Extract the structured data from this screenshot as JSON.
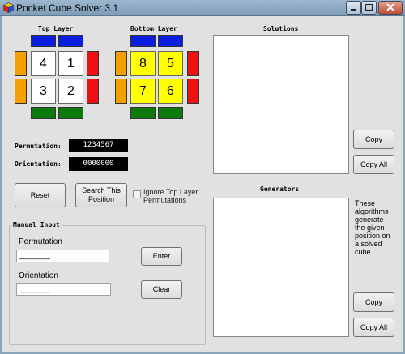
{
  "window": {
    "title": "Pocket Cube Solver 3.1"
  },
  "cube": {
    "top_label": "Top Layer",
    "bottom_label": "Bottom Layer",
    "top": [
      "4",
      "1",
      "3",
      "2"
    ],
    "bottom": [
      "8",
      "5",
      "7",
      "6"
    ]
  },
  "fields": {
    "permutation_label": "Permutation:",
    "permutation_value": "1234567",
    "orientation_label": "Orientation:",
    "orientation_value": "0000000"
  },
  "buttons": {
    "reset": "Reset",
    "search_line1": "Search This",
    "search_line2": "Position",
    "enter": "Enter",
    "clear": "Clear",
    "copy_solutions": "Copy",
    "copy_all_solutions": "Copy All",
    "copy_generators": "Copy",
    "copy_all_generators": "Copy All"
  },
  "checkbox": {
    "line1": "Ignore Top Layer",
    "line2": "Permutations",
    "checked": false
  },
  "manual_input": {
    "title": "Manual Input",
    "permutation_label": "Permutation",
    "permutation_value": "_______",
    "orientation_label": "Orientation",
    "orientation_value": "_______"
  },
  "solutions": {
    "title": "Solutions"
  },
  "generators": {
    "title": "Generators",
    "info_lines": [
      "These",
      "algorithms",
      "generate",
      "the given",
      "position on",
      "a solved",
      "cube."
    ]
  },
  "colors": {
    "blue": "#0a1ee0",
    "green": "#0b7a0b",
    "orange": "#f5a000",
    "red": "#ee1111",
    "white": "#ffffff",
    "yellow": "#ffff00"
  }
}
